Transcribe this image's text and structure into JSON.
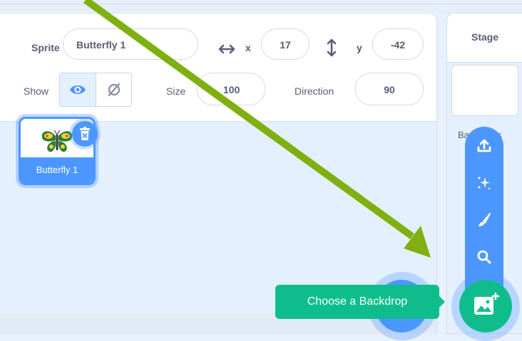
{
  "sprite_info": {
    "sprite_label": "Sprite",
    "sprite_name": "Butterfly 1",
    "x_label": "x",
    "x_value": "17",
    "y_label": "y",
    "y_value": "-42",
    "show_label": "Show",
    "size_label": "Size",
    "size_value": "100",
    "direction_label": "Direction",
    "direction_value": "90"
  },
  "sprite_list": [
    {
      "name": "Butterfly 1",
      "selected": true
    }
  ],
  "stage": {
    "title": "Stage",
    "backdrops_label": "Backdrops"
  },
  "backdrop_menu": {
    "items": [
      "upload-icon",
      "surprise-icon",
      "paint-icon",
      "search-icon"
    ],
    "tooltip": "Choose a Backdrop"
  },
  "colors": {
    "accent": "#4c97ff",
    "green": "#0fbd8c",
    "annotation_arrow": "#7fb010"
  }
}
